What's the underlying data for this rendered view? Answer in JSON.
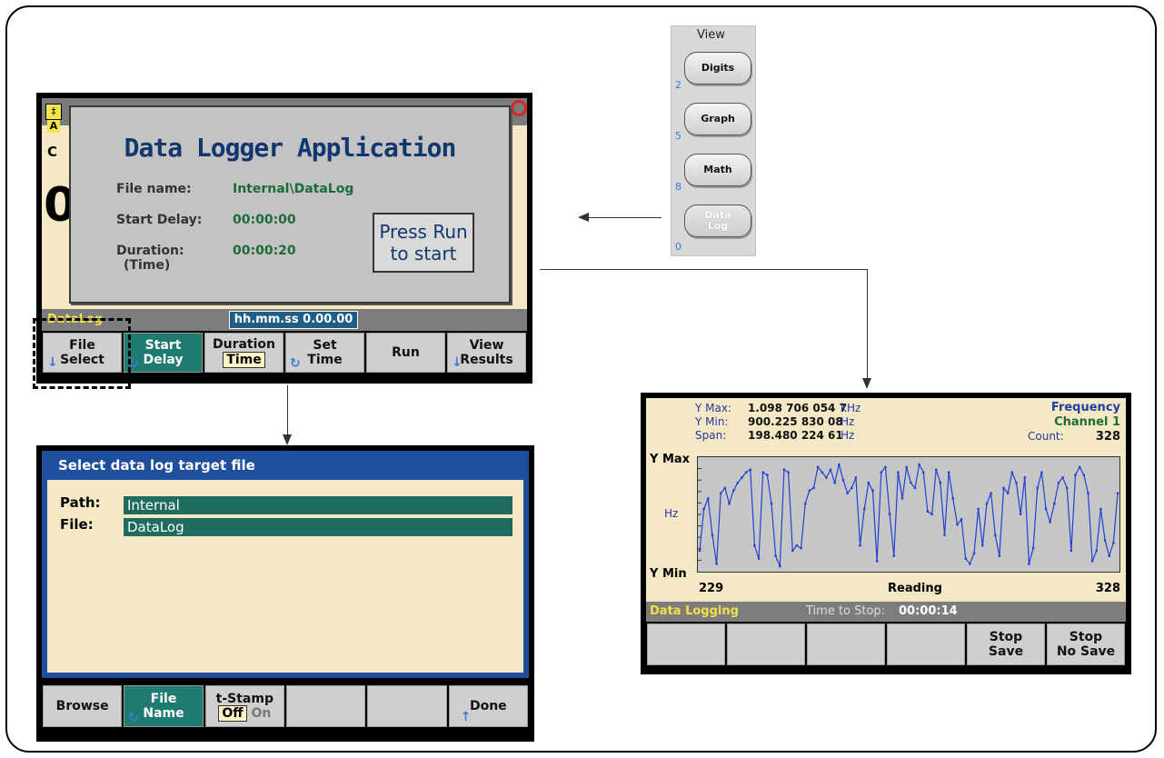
{
  "logger_screen": {
    "dialog_title": "Data Logger Application",
    "file_name_label": "File name:",
    "file_name_value": "Internal\\DataLog",
    "start_delay_label": "Start Delay:",
    "start_delay_value": "00:00:00",
    "duration_label": "Duration:",
    "duration_sub": "(Time)",
    "duration_value": "00:00:20",
    "press_run_line1": "Press Run",
    "press_run_line2": "to start",
    "status_label": "DataLog",
    "entry_value": "hh.mm.ss  0.00.00",
    "bg_big_digit": "0",
    "bg_small_c": "C",
    "bg_small_a": "A",
    "softkeys": [
      {
        "l1": "File",
        "l2": "Select",
        "icon": "down-arrow-icon"
      },
      {
        "l1": "Start",
        "l2": "Delay",
        "icon": "rotate-icon"
      },
      {
        "l1": "Duration",
        "l2": "Time"
      },
      {
        "l1": "Set",
        "l2": "Time",
        "icon": "rotate-icon"
      },
      {
        "l1": "Run",
        "l2": ""
      },
      {
        "l1": "View",
        "l2": "Results",
        "icon": "down-arrow-icon"
      }
    ]
  },
  "view_panel": {
    "title": "View",
    "buttons": [
      {
        "label": "Digits",
        "num": "2"
      },
      {
        "label": "Graph",
        "num": "5"
      },
      {
        "label": "Math",
        "num": "8"
      },
      {
        "label1": "Data",
        "label2": "Log",
        "num": "0"
      }
    ]
  },
  "file_screen": {
    "title": "Select data log target file",
    "path_label": "Path:",
    "path_value": "Internal",
    "file_label": "File:",
    "file_value": "DataLog",
    "softkeys": [
      {
        "l1": "Browse",
        "l2": ""
      },
      {
        "l1": "File",
        "l2": "Name"
      },
      {
        "l1": "t-Stamp",
        "off": "Off",
        "on": "On"
      },
      {
        "l1": "",
        "l2": ""
      },
      {
        "l1": "",
        "l2": ""
      },
      {
        "l1": "Done",
        "l2": ""
      }
    ]
  },
  "graph_screen": {
    "ymax_label": "Y Max:",
    "ymax_value": "1.098 706 054 7",
    "ymax_unit": "kHz",
    "ymin_label": "Y Min:",
    "ymin_value": "900.225 830 08",
    "ymin_unit": "Hz",
    "span_label": "Span:",
    "span_value": "198.480 224 61",
    "span_unit": "Hz",
    "function": "Frequency",
    "channel": "Channel 1",
    "count_label": "Count:",
    "count_value": "328",
    "axis_ymax": "Y Max",
    "axis_ymin": "Y Min",
    "axis_unit": "Hz",
    "x_start": "229",
    "x_label": "Reading",
    "x_end": "328",
    "status_label": "Data Logging",
    "time_to_stop_label": "Time to Stop:",
    "time_to_stop_value": "00:00:14",
    "softkeys": [
      {
        "l1": "",
        "l2": ""
      },
      {
        "l1": "",
        "l2": ""
      },
      {
        "l1": "",
        "l2": ""
      },
      {
        "l1": "",
        "l2": ""
      },
      {
        "l1": "Stop",
        "l2": "Save"
      },
      {
        "l1": "Stop",
        "l2": "No Save"
      }
    ]
  },
  "chart_data": {
    "type": "line",
    "x_range": [
      229,
      328
    ],
    "y_range": [
      900.22583008,
      1098.7060547
    ],
    "values": [
      930,
      1010,
      1030,
      960,
      905,
      1040,
      1050,
      1020,
      1045,
      1060,
      1070,
      1080,
      1085,
      940,
      915,
      1080,
      1075,
      1020,
      920,
      900,
      1085,
      1080,
      930,
      940,
      935,
      1020,
      1045,
      1050,
      1090,
      1080,
      1070,
      1085,
      1060,
      1095,
      1065,
      1040,
      1050,
      1070,
      940,
      1010,
      1060,
      1045,
      910,
      1080,
      1090,
      1000,
      920,
      1080,
      1030,
      1090,
      1060,
      1050,
      1095,
      1080,
      1005,
      1000,
      1085,
      1060,
      960,
      1080,
      1030,
      980,
      990,
      915,
      905,
      925,
      1010,
      940,
      1020,
      1040,
      960,
      920,
      1050,
      1040,
      1080,
      1060,
      1000,
      1070,
      905,
      935,
      1050,
      1080,
      1010,
      985,
      1020,
      1060,
      1070,
      1050,
      930,
      1075,
      1090,
      1075,
      1040,
      910,
      930,
      1010,
      950,
      920,
      945,
      1040
    ]
  },
  "colors": {
    "screen_bg": "#f5e9c5",
    "softkey_active": "#1f7a70",
    "title_blue": "#1f4f9c",
    "plot_line": "#2040d0",
    "status_yellow": "#f2e24a"
  }
}
